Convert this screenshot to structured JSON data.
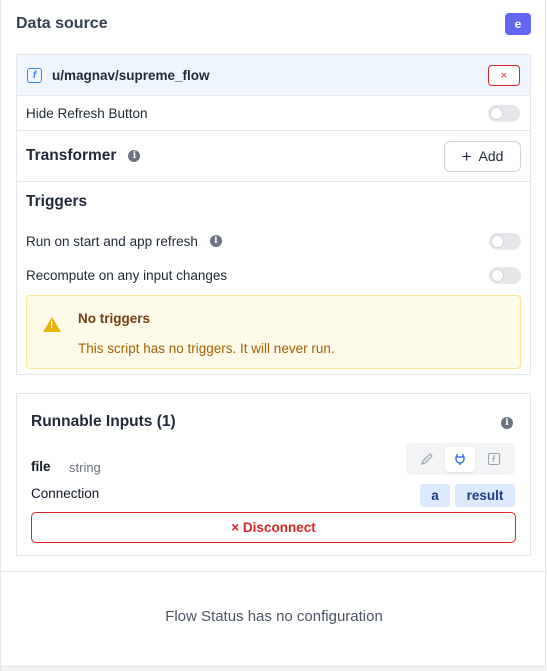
{
  "data_source": {
    "title": "Data source",
    "badge": "e",
    "badge_color": "#6366f1",
    "source_icon": "flow-icon",
    "source_path": "u/magnav/supreme_flow",
    "close_label": "×"
  },
  "settings": {
    "hide_refresh_label": "Hide Refresh Button",
    "hide_refresh_on": false
  },
  "transformer": {
    "title": "Transformer",
    "info": "i",
    "add_label": "Add"
  },
  "triggers": {
    "title": "Triggers",
    "run_on_start_label": "Run on start and app refresh",
    "run_on_start_on": false,
    "recompute_label": "Recompute on any input changes",
    "recompute_on": false,
    "warning_title": "No triggers",
    "warning_text": "This script has no triggers. It will never run."
  },
  "runnable_inputs": {
    "title": "Runnable Inputs (1)",
    "info": "i",
    "input_name": "file",
    "input_type": "string",
    "connection_label": "Connection",
    "chip_a": "a",
    "chip_result": "result",
    "disconnect_label": "× Disconnect",
    "modes": [
      "pencil-icon",
      "plug-icon",
      "function-icon"
    ]
  },
  "flow_status": {
    "message": "Flow Status has no configuration"
  },
  "colors": {
    "accent": "#2563eb",
    "danger": "#dc2626",
    "warning_bg": "#fefce8"
  }
}
